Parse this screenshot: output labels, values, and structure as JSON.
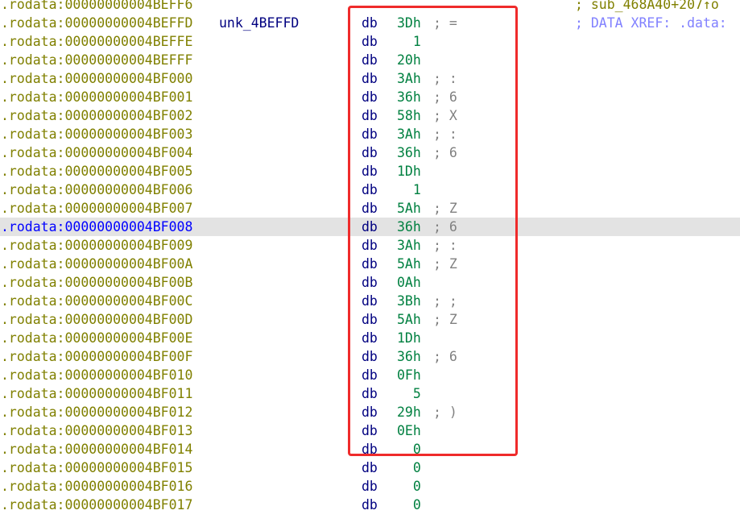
{
  "theme": {
    "address_color": "#808000",
    "highlight_address_color": "#0000ff",
    "mnemonic_color": "#000080",
    "operand_color": "#008040",
    "comment_color": "#808080",
    "xref_color": "#8080ff",
    "highlight_row_bg": "#e3e3e3",
    "annotation_box_color": "#ef2b2b"
  },
  "listing": {
    "rows": [
      {
        "address": ".rodata:00000000004BEFF6",
        "label": "",
        "mnemonic": "",
        "operand": "",
        "comment": "",
        "right": "; sub_468A40+207↑o"
      },
      {
        "address": ".rodata:00000000004BEFFD",
        "label": "unk_4BEFFD",
        "mnemonic": "db",
        "operand": "3Dh",
        "comment": "; =",
        "right": "; DATA XREF: .data:"
      },
      {
        "address": ".rodata:00000000004BEFFE",
        "label": "",
        "mnemonic": "db",
        "operand": "  1",
        "comment": "",
        "right": ""
      },
      {
        "address": ".rodata:00000000004BEFFF",
        "label": "",
        "mnemonic": "db",
        "operand": "20h",
        "comment": "",
        "right": ""
      },
      {
        "address": ".rodata:00000000004BF000",
        "label": "",
        "mnemonic": "db",
        "operand": "3Ah",
        "comment": "; :",
        "right": ""
      },
      {
        "address": ".rodata:00000000004BF001",
        "label": "",
        "mnemonic": "db",
        "operand": "36h",
        "comment": "; 6",
        "right": ""
      },
      {
        "address": ".rodata:00000000004BF002",
        "label": "",
        "mnemonic": "db",
        "operand": "58h",
        "comment": "; X",
        "right": ""
      },
      {
        "address": ".rodata:00000000004BF003",
        "label": "",
        "mnemonic": "db",
        "operand": "3Ah",
        "comment": "; :",
        "right": ""
      },
      {
        "address": ".rodata:00000000004BF004",
        "label": "",
        "mnemonic": "db",
        "operand": "36h",
        "comment": "; 6",
        "right": ""
      },
      {
        "address": ".rodata:00000000004BF005",
        "label": "",
        "mnemonic": "db",
        "operand": "1Dh",
        "comment": "",
        "right": ""
      },
      {
        "address": ".rodata:00000000004BF006",
        "label": "",
        "mnemonic": "db",
        "operand": "  1",
        "comment": "",
        "right": ""
      },
      {
        "address": ".rodata:00000000004BF007",
        "label": "",
        "mnemonic": "db",
        "operand": "5Ah",
        "comment": "; Z",
        "right": ""
      },
      {
        "address": ".rodata:00000000004BF008",
        "label": "",
        "mnemonic": "db",
        "operand": "36h",
        "comment": "; 6",
        "right": "",
        "highlighted": true
      },
      {
        "address": ".rodata:00000000004BF009",
        "label": "",
        "mnemonic": "db",
        "operand": "3Ah",
        "comment": "; :",
        "right": ""
      },
      {
        "address": ".rodata:00000000004BF00A",
        "label": "",
        "mnemonic": "db",
        "operand": "5Ah",
        "comment": "; Z",
        "right": ""
      },
      {
        "address": ".rodata:00000000004BF00B",
        "label": "",
        "mnemonic": "db",
        "operand": "0Ah",
        "comment": "",
        "right": ""
      },
      {
        "address": ".rodata:00000000004BF00C",
        "label": "",
        "mnemonic": "db",
        "operand": "3Bh",
        "comment": "; ;",
        "right": ""
      },
      {
        "address": ".rodata:00000000004BF00D",
        "label": "",
        "mnemonic": "db",
        "operand": "5Ah",
        "comment": "; Z",
        "right": ""
      },
      {
        "address": ".rodata:00000000004BF00E",
        "label": "",
        "mnemonic": "db",
        "operand": "1Dh",
        "comment": "",
        "right": ""
      },
      {
        "address": ".rodata:00000000004BF00F",
        "label": "",
        "mnemonic": "db",
        "operand": "36h",
        "comment": "; 6",
        "right": ""
      },
      {
        "address": ".rodata:00000000004BF010",
        "label": "",
        "mnemonic": "db",
        "operand": "0Fh",
        "comment": "",
        "right": ""
      },
      {
        "address": ".rodata:00000000004BF011",
        "label": "",
        "mnemonic": "db",
        "operand": "  5",
        "comment": "",
        "right": ""
      },
      {
        "address": ".rodata:00000000004BF012",
        "label": "",
        "mnemonic": "db",
        "operand": "29h",
        "comment": "; )",
        "right": ""
      },
      {
        "address": ".rodata:00000000004BF013",
        "label": "",
        "mnemonic": "db",
        "operand": "0Eh",
        "comment": "",
        "right": ""
      },
      {
        "address": ".rodata:00000000004BF014",
        "label": "",
        "mnemonic": "db",
        "operand": "  0",
        "comment": "",
        "right": ""
      },
      {
        "address": ".rodata:00000000004BF015",
        "label": "",
        "mnemonic": "db",
        "operand": "  0",
        "comment": "",
        "right": ""
      },
      {
        "address": ".rodata:00000000004BF016",
        "label": "",
        "mnemonic": "db",
        "operand": "  0",
        "comment": "",
        "right": ""
      },
      {
        "address": ".rodata:00000000004BF017",
        "label": "",
        "mnemonic": "db",
        "operand": "  0",
        "comment": "",
        "right": ""
      }
    ]
  }
}
